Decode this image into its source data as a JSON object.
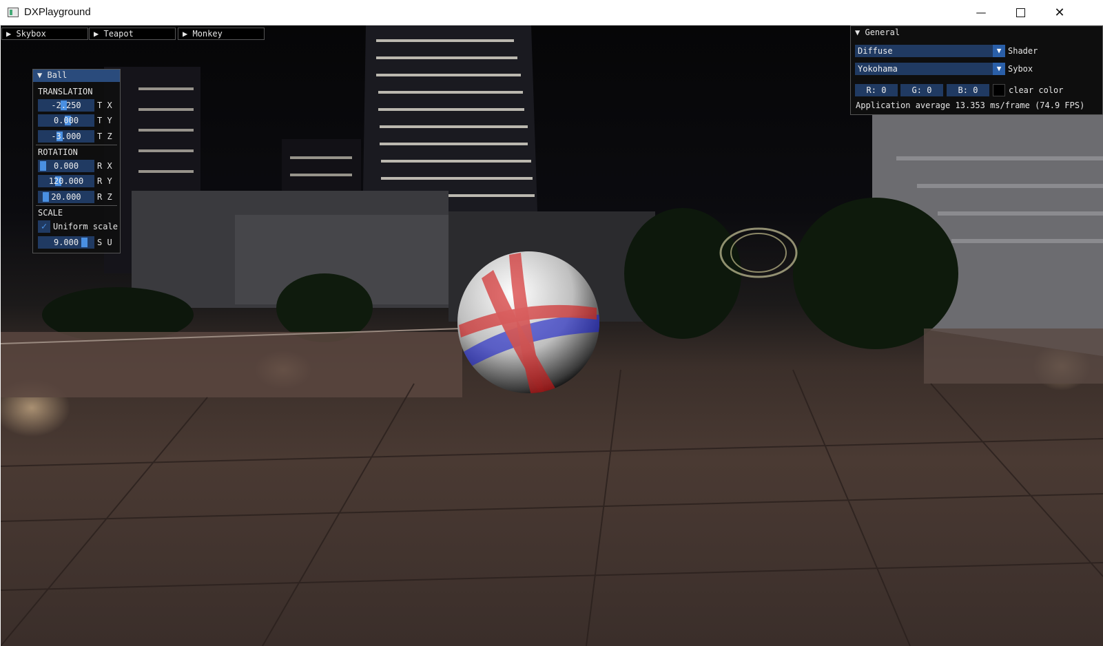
{
  "window": {
    "title": "DXPlayground",
    "minimize_icon": "minimize-icon",
    "maximize_icon": "maximize-icon",
    "close_icon": "close-icon"
  },
  "top_headers": [
    {
      "label": "Skybox",
      "icon": "triangle-right-icon"
    },
    {
      "label": "Teapot",
      "icon": "triangle-right-icon"
    },
    {
      "label": "Monkey",
      "icon": "triangle-right-icon"
    }
  ],
  "ball_panel": {
    "title": "Ball",
    "translation_label": "TRANSLATION",
    "rotation_label": "ROTATION",
    "scale_label": "SCALE",
    "tx": {
      "value": "-2.250",
      "label": "T X"
    },
    "ty": {
      "value": "0.000",
      "label": "T Y"
    },
    "tz": {
      "value": "-3.000",
      "label": "T Z"
    },
    "rx": {
      "value": "0.000",
      "label": "R X"
    },
    "ry": {
      "value": "120.000",
      "label": "R Y"
    },
    "rz": {
      "value": "20.000",
      "label": "R Z"
    },
    "uniform_scale": {
      "label": "Uniform scale",
      "checked": true
    },
    "su": {
      "value": "9.000",
      "label": "S U"
    }
  },
  "general_panel": {
    "title": "General",
    "shader": {
      "value": "Diffuse",
      "label": "Shader"
    },
    "skybox": {
      "value": "Yokohama",
      "label": "Sybox"
    },
    "clear_color": {
      "r": "R: 0",
      "g": "G: 0",
      "b": "B: 0",
      "label": "clear color",
      "swatch": "#000000"
    },
    "stats": "Application average 13.353 ms/frame (74.9 FPS)"
  },
  "colors": {
    "imgui_header": "#2a4b7c",
    "imgui_frame": "#203a62",
    "imgui_accent": "#4a90e2",
    "ball_red": "#d01515",
    "ball_blue": "#1a22c8"
  }
}
